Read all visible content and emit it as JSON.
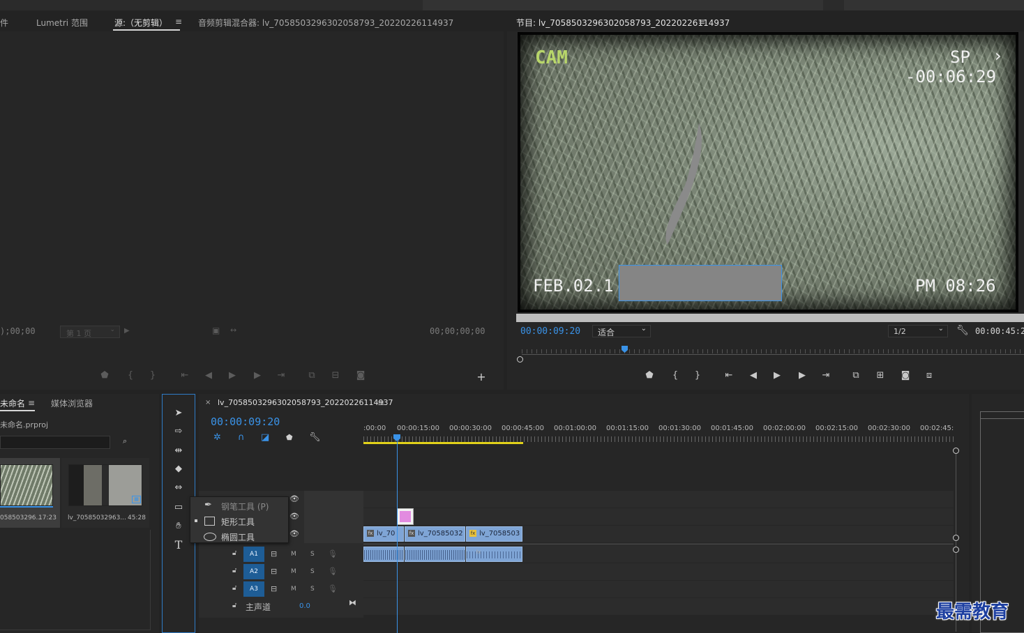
{
  "top_tabs": {
    "file_partial": "件",
    "lumetri": "Lumetri 范围",
    "source": "源:（无剪辑）",
    "audio_mixer": "音频剪辑混合器: lv_7058503296302058793_20220226114937"
  },
  "source_monitor": {
    "timecode_left": ");00;00",
    "page_select": "第 1 页",
    "timecode_right": "00;00;00;00"
  },
  "program_monitor": {
    "title": "节目: lv_7058503296302058793_20220226114937",
    "current_time": "00:00:09:20",
    "fit_select": "适合",
    "quality_select": "1/2",
    "duration": "00:00:45:2",
    "overlay": {
      "cam": "CAM",
      "sp": "SP",
      "time": "-00:06:29",
      "date": "FEB.02.1",
      "pm": "PM 08:26"
    }
  },
  "project_panel": {
    "tab_project": "未命名",
    "tab_media": "媒体浏览器",
    "file_name": "未命名.prproj",
    "items": [
      {
        "name": "058503296...",
        "duration": "17:23"
      },
      {
        "name": "lv_70585032963...",
        "duration": "45:28"
      }
    ]
  },
  "tool_popup": {
    "items": [
      {
        "label": "钢笔工具 (P)",
        "icon": "pen-icon"
      },
      {
        "label": "矩形工具",
        "icon": "rectangle-icon"
      },
      {
        "label": "椭圆工具",
        "icon": "ellipse-icon"
      }
    ]
  },
  "timeline": {
    "tab": "lv_7058503296302058793_20220226114937",
    "current_time": "00:00:09:20",
    "ruler": [
      ":00:00",
      "00:00:15:00",
      "00:00:30:00",
      "00:00:45:00",
      "00:01:00:00",
      "00:01:15:00",
      "00:01:30:00",
      "00:01:45:00",
      "00:02:00:00",
      "00:02:15:00",
      "00:02:30:00",
      "00:02:45:"
    ],
    "video_clips": [
      "lv_70",
      "lv_70585032",
      "lv_7058503"
    ],
    "audio_tracks": [
      "A1",
      "A2",
      "A3"
    ],
    "track_m": "M",
    "track_s": "S",
    "master_label": "主声道",
    "master_value": "0.0"
  },
  "watermark": "最需教育",
  "colors": {
    "accent_blue": "#3a93e8",
    "clip_blue": "#7fa5d6",
    "work_area_yellow": "#e2d21a",
    "graphic_pink": "#e28be0"
  }
}
